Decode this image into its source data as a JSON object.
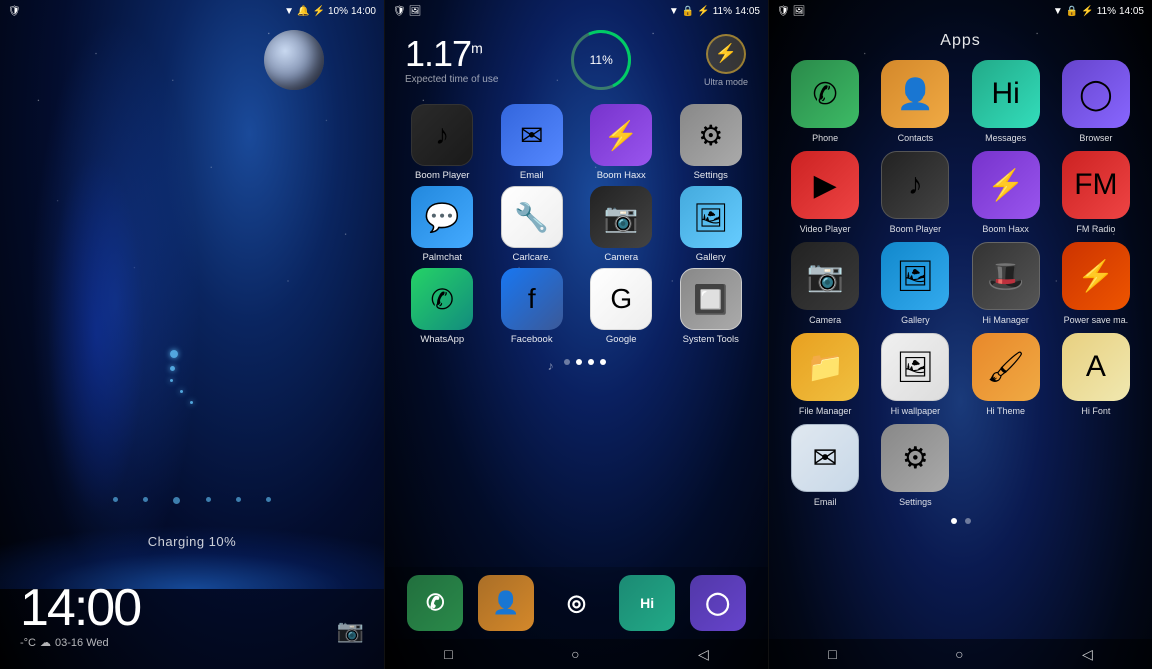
{
  "panel1": {
    "status": {
      "left_icon": "📶",
      "signal": "▼",
      "notifications": "🔔",
      "battery_icon": "🔋",
      "battery_pct": "10%",
      "time": "14:00"
    },
    "time_display": "14:00",
    "time_superscript": "",
    "charging_text": "Charging 10%",
    "date": "03-16 Wed",
    "temp": "-°C"
  },
  "panel2": {
    "status": {
      "battery_pct": "11%",
      "time": "14:05"
    },
    "widget": {
      "time": "1.17",
      "unit": "m",
      "sub_label": "Expected time of use",
      "battery_pct": "11%",
      "ultra_label": "Ultra mode"
    },
    "apps": [
      {
        "label": "Boom Player",
        "icon_class": "icon-boom",
        "symbol": "♪"
      },
      {
        "label": "Email",
        "icon_class": "icon-email",
        "symbol": "✉"
      },
      {
        "label": "Boom Haxx",
        "icon_class": "icon-boomhaxx",
        "symbol": "⚡"
      },
      {
        "label": "Settings",
        "icon_class": "icon-settings",
        "symbol": "⚙"
      },
      {
        "label": "Palmchat",
        "icon_class": "icon-palmchat",
        "symbol": "💬"
      },
      {
        "label": "Carlcare.",
        "icon_class": "icon-carlcare",
        "symbol": "🔧"
      },
      {
        "label": "Camera",
        "icon_class": "icon-camera",
        "symbol": "📷"
      },
      {
        "label": "Gallery",
        "icon_class": "icon-gallery",
        "symbol": "🖼"
      },
      {
        "label": "WhatsApp",
        "icon_class": "icon-whatsapp",
        "symbol": "✆"
      },
      {
        "label": "Facebook",
        "icon_class": "icon-facebook",
        "symbol": "f"
      },
      {
        "label": "Google",
        "icon_class": "icon-google",
        "symbol": "G"
      },
      {
        "label": "System Tools",
        "icon_class": "icon-systemtools",
        "symbol": "🔲"
      }
    ],
    "dock": [
      {
        "label": "Phone",
        "color": "#2a8a4a",
        "symbol": "✆"
      },
      {
        "label": "Contacts",
        "color": "#d4882a",
        "symbol": "👤"
      },
      {
        "label": "Launcher",
        "color": "#333",
        "symbol": "◎"
      },
      {
        "label": "Hi",
        "color": "#22aa88",
        "symbol": "Hi"
      },
      {
        "label": "Browser",
        "color": "#6644cc",
        "symbol": "◯"
      }
    ],
    "page_dots": [
      false,
      true,
      true,
      true
    ]
  },
  "panel3": {
    "status": {
      "battery_pct": "11%",
      "time": "14:05"
    },
    "title": "Apps",
    "apps": [
      {
        "label": "Phone",
        "icon_class": "di-phone",
        "symbol": "✆"
      },
      {
        "label": "Contacts",
        "icon_class": "di-contacts",
        "symbol": "👤"
      },
      {
        "label": "Messages",
        "icon_class": "di-messages",
        "symbol": "Hi"
      },
      {
        "label": "Browser",
        "icon_class": "di-browser",
        "symbol": "◯"
      },
      {
        "label": "Video Player",
        "icon_class": "di-videoplayer",
        "symbol": "▶"
      },
      {
        "label": "Boom Player",
        "icon_class": "di-boomplayer",
        "symbol": "♪"
      },
      {
        "label": "Boom Haxx",
        "icon_class": "di-boomhaxx",
        "symbol": "⚡"
      },
      {
        "label": "FM Radio",
        "icon_class": "di-fmradio",
        "symbol": "FM"
      },
      {
        "label": "Camera",
        "icon_class": "di-camera",
        "symbol": "📷"
      },
      {
        "label": "Gallery",
        "icon_class": "di-gallery",
        "symbol": "🖼"
      },
      {
        "label": "Hi Manager",
        "icon_class": "di-himanager",
        "symbol": "🎩"
      },
      {
        "label": "Power save ma.",
        "icon_class": "di-powersave",
        "symbol": "⚡"
      },
      {
        "label": "File Manager",
        "icon_class": "di-filemanager",
        "symbol": "📁"
      },
      {
        "label": "Hi wallpaper",
        "icon_class": "di-hiwallpaper",
        "symbol": "🖼"
      },
      {
        "label": "Hi Theme",
        "icon_class": "di-hitheme",
        "symbol": "🖌"
      },
      {
        "label": "Hi Font",
        "icon_class": "di-hifont",
        "symbol": "A"
      },
      {
        "label": "Email",
        "icon_class": "di-email",
        "symbol": "✉"
      },
      {
        "label": "Settings",
        "icon_class": "di-settings",
        "symbol": "⚙"
      }
    ],
    "page_dots": [
      true,
      false
    ]
  }
}
